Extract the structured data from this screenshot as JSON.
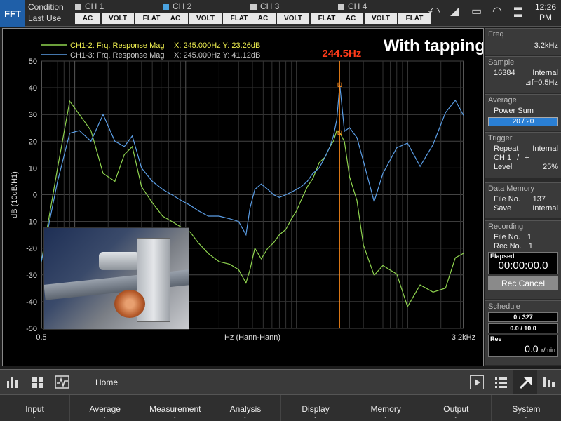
{
  "mode": {
    "label": "FFT"
  },
  "condition": {
    "title": "Condition",
    "subtitle": "Last Use"
  },
  "channels": [
    {
      "name": "CH 1",
      "checked": false,
      "buttons": [
        "AC",
        "VOLT",
        "FLAT"
      ]
    },
    {
      "name": "CH 2",
      "checked": true,
      "buttons": [
        "AC",
        "VOLT",
        "FLAT"
      ]
    },
    {
      "name": "CH 3",
      "checked": false,
      "buttons": [
        "AC",
        "VOLT",
        "FLAT"
      ]
    },
    {
      "name": "CH 4",
      "checked": false,
      "buttons": [
        "AC",
        "VOLT",
        "FLAT"
      ]
    }
  ],
  "clock": {
    "time": "12:26",
    "ampm": "PM"
  },
  "annotation": {
    "marker_label": "244.5Hz",
    "title": "With tapping"
  },
  "chart_data": {
    "type": "line",
    "xlabel": "Hz (Hann-Hann)",
    "ylabel": "dB (10dB/H1)",
    "x_tick_labels": [
      "0.5",
      "3.2kHz"
    ],
    "xlim": [
      0.5,
      3200
    ],
    "ylim": [
      -50,
      50
    ],
    "y_ticks": [
      50,
      40,
      30,
      20,
      10,
      0,
      -10,
      -20,
      -30,
      -40,
      -50
    ],
    "log_x": true,
    "grid": true,
    "marker_x": 244.5,
    "colors": {
      "green": "#8fd44f",
      "blue": "#5b9ee6",
      "marker": "#ff8c1a",
      "annotation": "#ff3b1a"
    },
    "series": [
      {
        "name": "CH1-2: Frq. Response Mag",
        "readout": "X: 245.000Hz Y: 23.26dB",
        "color": "#8fd44f",
        "x": [
          0.5,
          0.7,
          0.9,
          1.1,
          1.4,
          1.8,
          2.3,
          2.8,
          3.3,
          4.0,
          5.0,
          6.2,
          7.5,
          9,
          11,
          13,
          16,
          20,
          25,
          30,
          35,
          38,
          42,
          48,
          55,
          62,
          70,
          80,
          90,
          100,
          110,
          125,
          140,
          160,
          180,
          200,
          215,
          230,
          245,
          270,
          300,
          350,
          400,
          500,
          600,
          800,
          1000,
          1300,
          1700,
          2200,
          2700,
          3200
        ],
        "y": [
          -25,
          10,
          35,
          30,
          24,
          8,
          5,
          15,
          18,
          3,
          -3,
          -8,
          -10,
          -12,
          -14,
          -18,
          -22,
          -25,
          -26,
          -28,
          -33,
          -28,
          -20,
          -24,
          -20,
          -18,
          -15,
          -13,
          -9,
          -6,
          -2,
          3,
          6,
          12,
          14,
          18,
          20,
          24,
          23.26,
          15,
          5,
          -10,
          -18,
          -25,
          -30,
          -35,
          -38,
          -34,
          -30,
          -28,
          -20,
          -15
        ]
      },
      {
        "name": "CH1-3: Frq. Response Mag",
        "readout": "X: 245.000Hz Y: 41.12dB",
        "color": "#5b9ee6",
        "x": [
          0.5,
          0.7,
          0.9,
          1.1,
          1.4,
          1.8,
          2.3,
          2.8,
          3.3,
          4.0,
          5.0,
          6.2,
          7.5,
          9,
          11,
          13,
          16,
          20,
          25,
          30,
          35,
          38,
          42,
          48,
          55,
          62,
          70,
          80,
          90,
          100,
          110,
          125,
          140,
          160,
          180,
          200,
          215,
          230,
          245,
          270,
          300,
          350,
          400,
          500,
          600,
          800,
          1000,
          1300,
          1700,
          2200,
          2700,
          3200
        ],
        "y": [
          -25,
          5,
          23,
          24,
          20,
          30,
          20,
          18,
          22,
          10,
          5,
          2,
          0,
          -2,
          -4,
          -6,
          -8,
          -8,
          -9,
          -10,
          -15,
          -5,
          2,
          4,
          2,
          0,
          -1,
          0,
          1,
          2,
          3,
          5,
          8,
          10,
          14,
          18,
          22,
          28,
          41.12,
          28,
          20,
          15,
          10,
          5,
          8,
          12,
          15,
          18,
          20,
          22,
          28,
          30
        ]
      }
    ]
  },
  "sidebar": {
    "freq": {
      "label": "Freq",
      "value": "3.2kHz"
    },
    "sample": {
      "label": "Sample",
      "count": "16384",
      "mode": "Internal",
      "df": "⊿f=0.5Hz"
    },
    "average": {
      "label": "Average",
      "type": "Power Sum",
      "progress": "20 / 20",
      "progress_fraction": 1.0
    },
    "trigger": {
      "label": "Trigger",
      "repeat_label": "Repeat",
      "repeat_value": "Internal",
      "ch_label": "CH 1",
      "ch_sep": "/",
      "ch_value": "+",
      "level_label": "Level",
      "level_value": "25%"
    },
    "data_memory": {
      "label": "Data Memory",
      "file_label": "File No.",
      "file_value": "137",
      "save_label": "Save",
      "save_value": "Internal"
    },
    "recording": {
      "label": "Recording",
      "file_label": "File No.",
      "file_value": "1",
      "rec_label": "Rec No.",
      "rec_value": "1",
      "elapsed_label": "Elapsed",
      "elapsed_value": "00:00:00.0",
      "cancel_label": "Rec Cancel"
    },
    "schedule": {
      "label": "Schedule",
      "count": "0 / 327",
      "time": "0.0 / 10.0",
      "rev_label": "Rev",
      "rev_value": "0.0",
      "rev_unit": "r/min"
    }
  },
  "bottombar": {
    "home_label": "Home"
  },
  "menu": [
    "Input",
    "Average",
    "Measurement",
    "Analysis",
    "Display",
    "Memory",
    "Output",
    "System"
  ],
  "inset": {
    "description": ""
  }
}
